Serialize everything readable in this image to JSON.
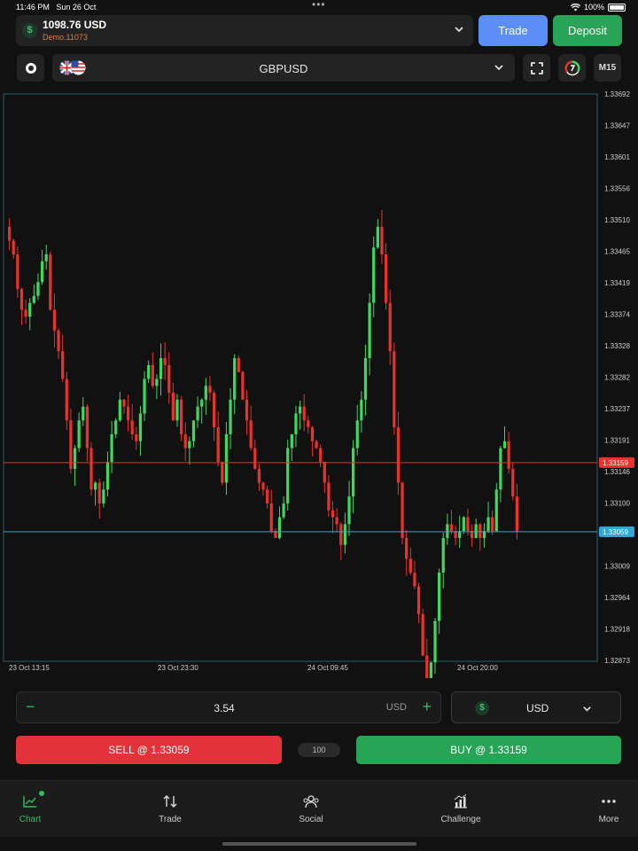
{
  "status_bar": {
    "time": "11:46 PM",
    "date": "Sun 26 Oct",
    "battery": "100%"
  },
  "account": {
    "balance": "1098.76 USD",
    "account_id": "Demo.11073",
    "icon": "dollar-icon"
  },
  "header_buttons": {
    "trade": "Trade",
    "deposit": "Deposit"
  },
  "symbol_bar": {
    "symbol": "GBPUSD",
    "timeframe": "M15",
    "icons": [
      "settings-icon",
      "gb-us-flags-icon",
      "fullscreen-icon",
      "indicators-icon"
    ]
  },
  "colors": {
    "bull": "#3fd85f",
    "bear": "#e8322b",
    "bid_line": "#e8322b",
    "ask_line": "#2fa8d5",
    "background": "#111111",
    "buy": "#27a455",
    "sell": "#e3333a",
    "trade": "#5b8ef7"
  },
  "chart_data": {
    "type": "candlestick",
    "y_ticks": [
      "1.33692",
      "1.33647",
      "1.33601",
      "1.33556",
      "1.33510",
      "1.33465",
      "1.33419",
      "1.33374",
      "1.33328",
      "1.33282",
      "1.33237",
      "1.33191",
      "1.33146",
      "1.33100",
      "1.33055",
      "1.33009",
      "1.32964",
      "1.32918",
      "1.32873"
    ],
    "ylim": [
      1.32873,
      1.33692
    ],
    "x_ticks": [
      "23 Oct 13:15",
      "23 Oct 23:30",
      "24 Oct 09:45",
      "24 Oct 20:00"
    ],
    "bid_label": "1.33159",
    "ask_label": "1.33059",
    "bid": 1.33159,
    "ask": 1.33059,
    "close_series": [
      1.335,
      1.3348,
      1.3346,
      1.3341,
      1.3338,
      1.3337,
      1.3339,
      1.334,
      1.3342,
      1.3345,
      1.3346,
      1.3338,
      1.3335,
      1.3332,
      1.3328,
      1.3322,
      1.3315,
      1.3318,
      1.3322,
      1.3324,
      1.3318,
      1.3312,
      1.3313,
      1.331,
      1.3312,
      1.3316,
      1.332,
      1.3322,
      1.3325,
      1.3324,
      1.3322,
      1.332,
      1.3319,
      1.3323,
      1.3328,
      1.333,
      1.3327,
      1.3328,
      1.3331,
      1.333,
      1.3326,
      1.3322,
      1.3325,
      1.332,
      1.3318,
      1.3319,
      1.3322,
      1.3324,
      1.3325,
      1.3327,
      1.3326,
      1.3321,
      1.3316,
      1.3313,
      1.332,
      1.3325,
      1.3331,
      1.3329,
      1.3325,
      1.3322,
      1.3318,
      1.3315,
      1.3313,
      1.3312,
      1.331,
      1.3306,
      1.3305,
      1.3308,
      1.331,
      1.3318,
      1.332,
      1.3323,
      1.3324,
      1.3322,
      1.3321,
      1.3319,
      1.3318,
      1.3316,
      1.3313,
      1.3309,
      1.3308,
      1.3307,
      1.3304,
      1.3307,
      1.3311,
      1.3318,
      1.3322,
      1.3325,
      1.3331,
      1.3339,
      1.3347,
      1.335,
      1.3346,
      1.3339,
      1.3332,
      1.3321,
      1.3313,
      1.3305,
      1.3302,
      1.33,
      1.3298,
      1.3294,
      1.3288,
      1.3283,
      1.3287,
      1.3293,
      1.33,
      1.3305,
      1.3307,
      1.3306,
      1.3305,
      1.3306,
      1.3308,
      1.3306,
      1.3305,
      1.3307,
      1.3305,
      1.3306,
      1.3308,
      1.3306,
      1.3312,
      1.3318,
      1.3319,
      1.3315,
      1.3311,
      1.3306
    ]
  },
  "order": {
    "amount": "3.54",
    "amount_currency": "USD",
    "currency_select": "USD",
    "sell_label": "SELL @ 1.33059",
    "buy_label": "BUY @ 1.33159",
    "spread": "100"
  },
  "nav": [
    {
      "label": "Chart",
      "icon": "chart-icon",
      "active": true
    },
    {
      "label": "Trade",
      "icon": "arrows-updown-icon",
      "active": false
    },
    {
      "label": "Social",
      "icon": "social-icon",
      "active": false
    },
    {
      "label": "Challenge",
      "icon": "challenge-icon",
      "active": false
    },
    {
      "label": "More",
      "icon": "more-icon",
      "active": false
    }
  ]
}
